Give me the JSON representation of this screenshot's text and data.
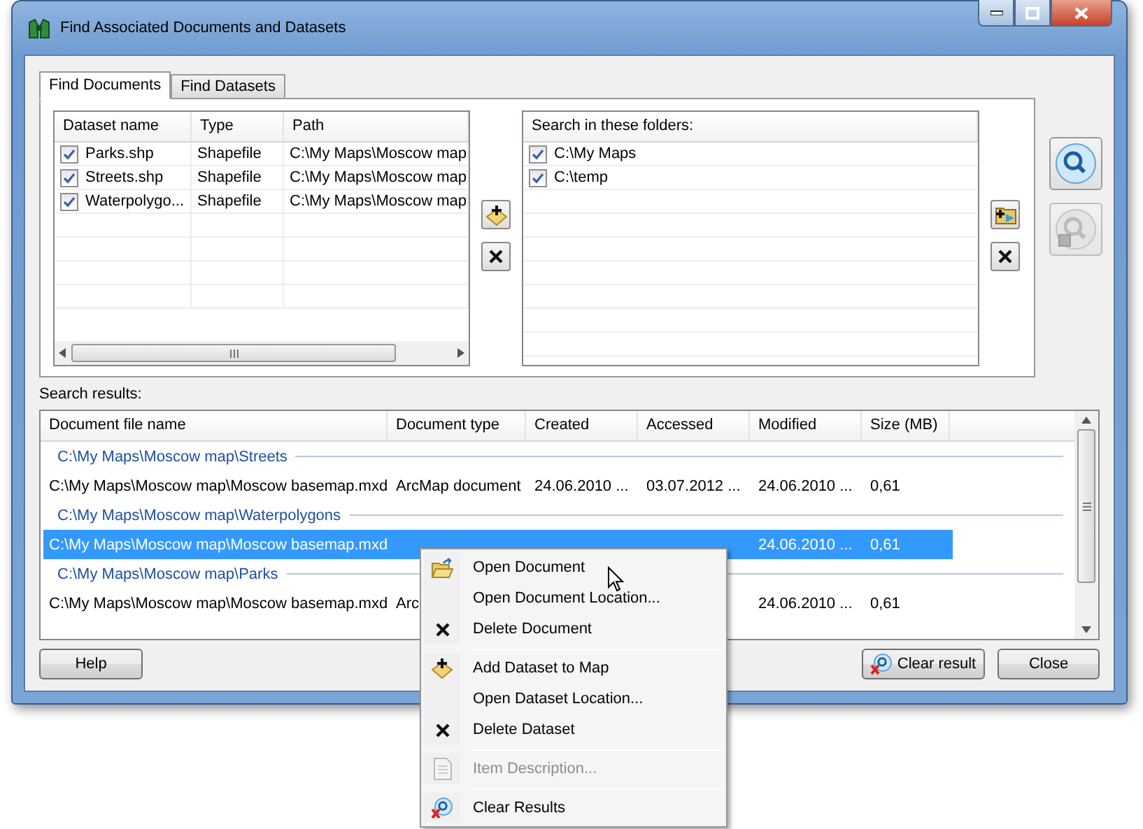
{
  "window": {
    "title": "Find Associated Documents and Datasets"
  },
  "tabs": [
    {
      "label": "Find Documents",
      "selected": true
    },
    {
      "label": "Find Datasets",
      "selected": false
    }
  ],
  "datasets": {
    "columns": [
      "Dataset name",
      "Type",
      "Path"
    ],
    "rows": [
      {
        "name": "Parks.shp",
        "type": "Shapefile",
        "path": "C:\\My Maps\\Moscow map",
        "checked": true
      },
      {
        "name": "Streets.shp",
        "type": "Shapefile",
        "path": "C:\\My Maps\\Moscow map",
        "checked": true
      },
      {
        "name": "Waterpolygo...",
        "type": "Shapefile",
        "path": "C:\\My Maps\\Moscow map",
        "checked": true
      }
    ]
  },
  "folders": {
    "header": "Search in these folders:",
    "rows": [
      {
        "path": "C:\\My Maps",
        "checked": true
      },
      {
        "path": "C:\\temp",
        "checked": true
      }
    ]
  },
  "results": {
    "label": "Search results:",
    "columns": [
      "Document file name",
      "Document type",
      "Created",
      "Accessed",
      "Modified",
      "Size (MB)"
    ],
    "groups": [
      {
        "path": "C:\\My Maps\\Moscow map\\Streets",
        "rows": [
          {
            "file": "C:\\My Maps\\Moscow map\\Moscow basemap.mxd",
            "type": "ArcMap document",
            "created": "24.06.2010 ...",
            "accessed": "03.07.2012 ...",
            "modified": "24.06.2010 ...",
            "size": "0,61",
            "selected": false
          }
        ]
      },
      {
        "path": "C:\\My Maps\\Moscow map\\Waterpolygons",
        "rows": [
          {
            "file": "C:\\My Maps\\Moscow map\\Moscow basemap.mxd",
            "modified": "24.06.2010 ...",
            "size": "0,61",
            "selected": true
          }
        ]
      },
      {
        "path": "C:\\My Maps\\Moscow map\\Parks",
        "rows": [
          {
            "file": "C:\\My Maps\\Moscow map\\Moscow basemap.mxd",
            "type": "Arc",
            "modified": "24.06.2010 ...",
            "size": "0,61",
            "selected": false
          }
        ]
      }
    ]
  },
  "buttons": {
    "help": "Help",
    "clear": "Clear result",
    "close": "Close"
  },
  "context_menu": [
    {
      "kind": "item",
      "label": "Open Document",
      "disabled": false
    },
    {
      "kind": "item",
      "label": "Open Document Location...",
      "disabled": false
    },
    {
      "kind": "item",
      "label": "Delete Document",
      "disabled": false
    },
    {
      "kind": "separator"
    },
    {
      "kind": "item",
      "label": "Add Dataset to Map",
      "disabled": false
    },
    {
      "kind": "item",
      "label": "Open Dataset Location...",
      "disabled": false
    },
    {
      "kind": "item",
      "label": "Delete Dataset",
      "disabled": false
    },
    {
      "kind": "separator"
    },
    {
      "kind": "item",
      "label": "Item Description...",
      "disabled": true
    },
    {
      "kind": "separator"
    },
    {
      "kind": "item",
      "label": "Clear Results",
      "disabled": false
    }
  ]
}
